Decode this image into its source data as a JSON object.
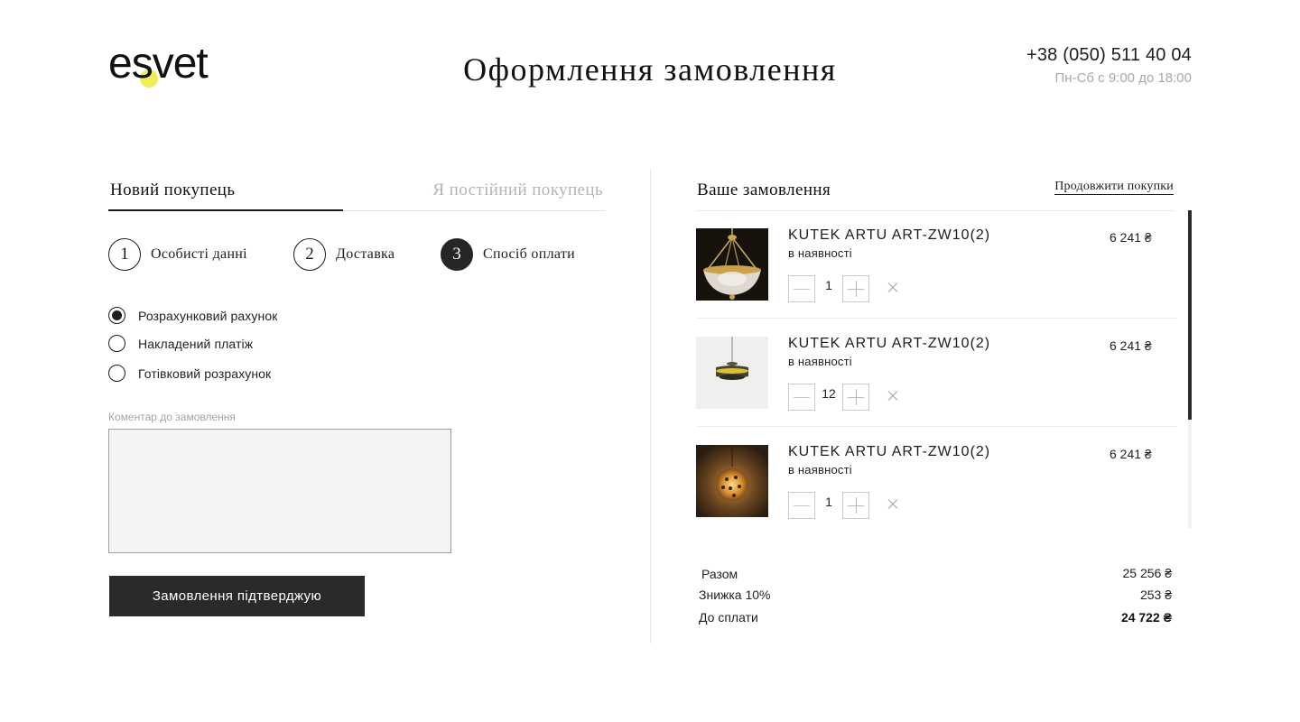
{
  "header": {
    "logo_text": "esvet",
    "title": "Оформлення замовлення",
    "phone": "+38 (050) 511 40 04",
    "hours": "Пн-Сб с 9:00 до 18:00"
  },
  "tabs": {
    "new_customer": "Новий покупець",
    "regular_customer": "Я постійний покупець",
    "active": "new_customer"
  },
  "steps": [
    {
      "number": "1",
      "label": "Особисті данні",
      "active": false
    },
    {
      "number": "2",
      "label": "Доставка",
      "active": false
    },
    {
      "number": "3",
      "label": "Спосіб оплати",
      "active": true
    }
  ],
  "payment": {
    "options": [
      {
        "label": "Розрахунковий рахунок",
        "checked": true
      },
      {
        "label": "Накладений платіж",
        "checked": false
      },
      {
        "label": "Готівковий розрахунок",
        "checked": false
      }
    ]
  },
  "comment": {
    "label": "Коментар до замовлення",
    "value": ""
  },
  "confirm_button": "Замовлення підтверджую",
  "order": {
    "title": "Ваше замовлення",
    "continue_link": "Продовжити покупки",
    "items": [
      {
        "name": "KUTEK ARTU ART-ZW10(2)",
        "stock": "в наявності",
        "price": "6 241 ₴",
        "qty": "1",
        "image": "brass-chandelier-photo"
      },
      {
        "name": "KUTEK ARTU ART-ZW10(2)",
        "stock": "в наявності",
        "price": "6 241 ₴",
        "qty": "12",
        "image": "pendant-disc-lamp-photo"
      },
      {
        "name": "KUTEK ARTU ART-ZW10(2)",
        "stock": "в наявності",
        "price": "6 241 ₴",
        "qty": "1",
        "image": "globe-lantern-photo"
      }
    ],
    "scroll_position": 0
  },
  "summary": {
    "subtotal_label": "Разом",
    "subtotal_value": "25 256 ₴",
    "discount_label": "Знижка 10%",
    "discount_value": "253 ₴",
    "total_label": "До сплати",
    "total_value": "24 722 ₴"
  },
  "colors": {
    "accent_yellow": "#f3ec5a",
    "dark": "#262626",
    "muted": "#b4b4b4"
  }
}
